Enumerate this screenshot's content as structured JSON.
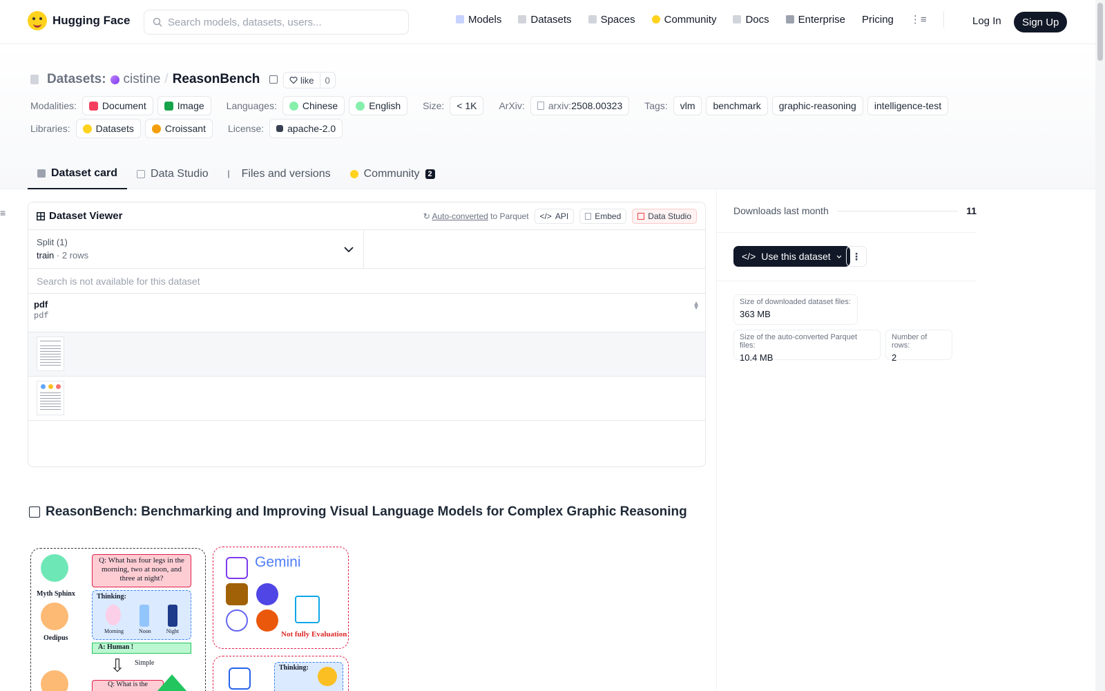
{
  "nav": {
    "brand": "Hugging Face",
    "search_placeholder": "Search models, datasets, users...",
    "links": [
      "Models",
      "Datasets",
      "Spaces",
      "Community",
      "Docs",
      "Enterprise",
      "Pricing"
    ],
    "login": "Log In",
    "signup": "Sign Up"
  },
  "header": {
    "section": "Datasets:",
    "owner": "cistine",
    "separator": "/",
    "repo": "ReasonBench",
    "like_label": "like",
    "like_count": "0"
  },
  "tags": {
    "modalities_label": "Modalities:",
    "modalities": [
      "Document",
      "Image"
    ],
    "languages_label": "Languages:",
    "languages": [
      "Chinese",
      "English"
    ],
    "size_label": "Size:",
    "size": "< 1K",
    "arxiv_label": "ArXiv:",
    "arxiv_prefix": "arxiv:",
    "arxiv_id": "2508.00323",
    "tags_label": "Tags:",
    "tags": [
      "vlm",
      "benchmark",
      "graphic-reasoning",
      "intelligence-test"
    ],
    "libraries_label": "Libraries:",
    "libraries": [
      "Datasets",
      "Croissant"
    ],
    "license_label": "License:",
    "license": "apache-2.0"
  },
  "tabs": [
    {
      "label": "Dataset card"
    },
    {
      "label": "Data Studio"
    },
    {
      "label": "Files and versions"
    },
    {
      "label": "Community",
      "count": "2"
    }
  ],
  "viewer": {
    "title": "Dataset Viewer",
    "autoconv_link": "Auto-converted",
    "autoconv_rest": "to Parquet",
    "api": "API",
    "embed": "Embed",
    "studio": "Data Studio",
    "split_label": "Split (1)",
    "split_name": "train",
    "split_dot": "·",
    "split_rows": "2 rows",
    "search_msg": "Search is not available for this dataset",
    "column_name": "pdf",
    "column_type": "pdf"
  },
  "card": {
    "title": "ReasonBench: Benchmarking and Improving Visual Language Models for Complex Graphic Reasoning",
    "figure": {
      "q1": "Q: What has four legs in the morning, two at noon, and three at night?",
      "thinking": "Thinking:",
      "morning": "Morning",
      "noon": "Noon",
      "night": "Night",
      "answer": "A: Human !",
      "myth": "Myth Sphinx",
      "oedipus": "Oedipus",
      "simple": "Simple",
      "q2": "Q: What is the",
      "gemini": "Gemini",
      "not_full": "Not fully Evaluation",
      "thinking2": "Thinking:"
    }
  },
  "sidebar": {
    "downloads_label": "Downloads last month",
    "downloads": "11",
    "use_button": "Use this dataset",
    "stats": [
      {
        "label": "Size of downloaded dataset files:",
        "value": "363 MB"
      },
      {
        "label": "Size of the auto-converted Parquet files:",
        "value": "10.4 MB"
      },
      {
        "label": "Number of rows:",
        "value": "2"
      }
    ]
  }
}
